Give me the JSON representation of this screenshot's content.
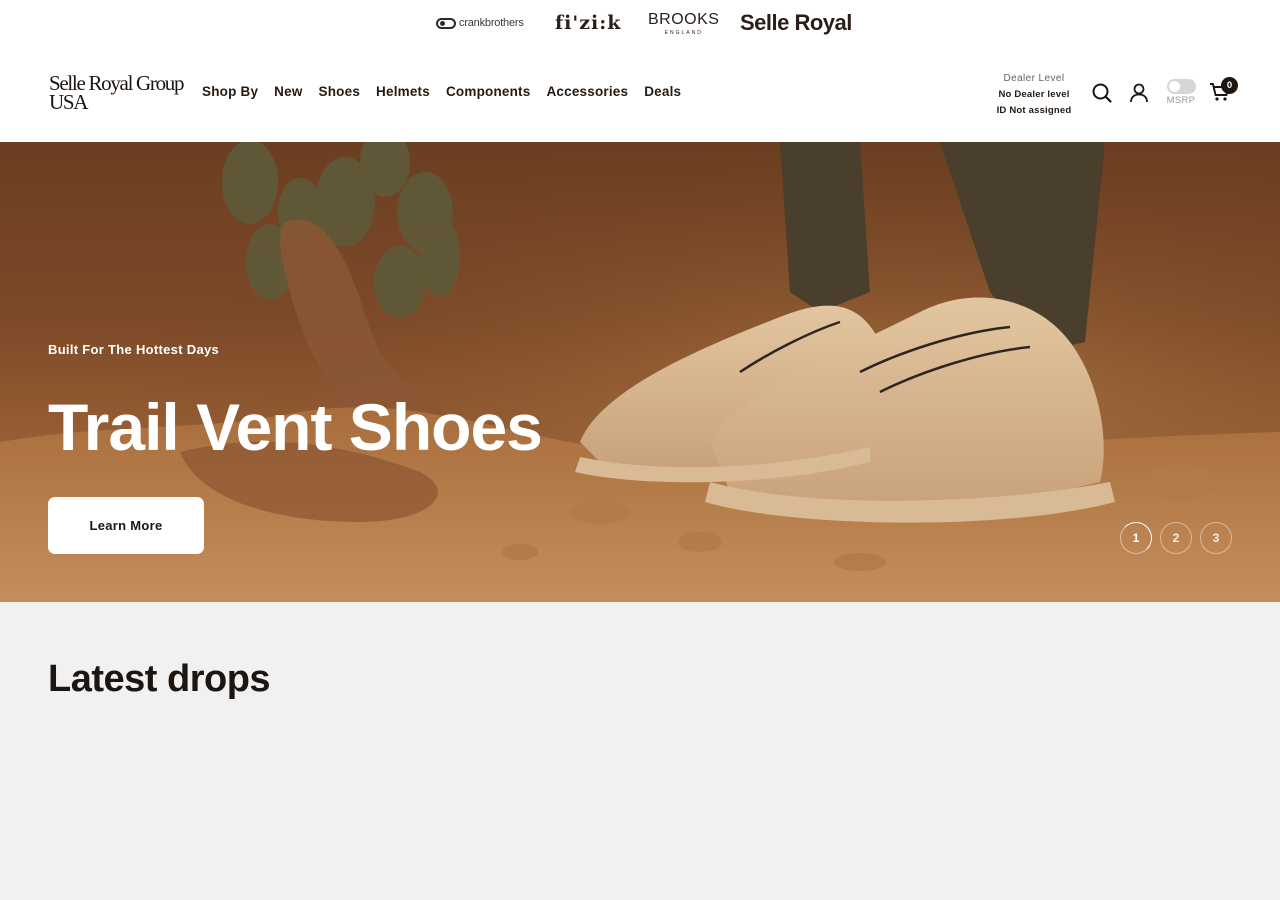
{
  "brand_bar": {
    "brands": [
      {
        "label": "crankbrothers"
      },
      {
        "label": "fi'zi:k"
      },
      {
        "label": "BROOKS",
        "sub": "ENGLAND"
      },
      {
        "label": "Selle Royal"
      }
    ]
  },
  "header": {
    "logo_line1": "Selle Royal Group",
    "logo_line2": "USA",
    "nav": [
      "Shop By",
      "New",
      "Shoes",
      "Helmets",
      "Components",
      "Accessories",
      "Deals"
    ],
    "dealer": {
      "title": "Dealer Level",
      "level": "No Dealer level",
      "id": "ID Not assigned"
    },
    "msrp_label": "MSRP",
    "cart_count": "0",
    "icons": {
      "search": "search-icon",
      "account": "user-icon",
      "cart": "cart-icon"
    }
  },
  "hero": {
    "eyebrow": "Built For The Hottest Days",
    "title": "Trail Vent Shoes",
    "cta": "Learn More",
    "slides": [
      "1",
      "2",
      "3"
    ],
    "active_slide": 1
  },
  "latest": {
    "title": "Latest drops"
  },
  "colors": {
    "dark": "#1c1510",
    "hero_bg": "#7e4a28",
    "page_bg": "#f1f1f1"
  }
}
